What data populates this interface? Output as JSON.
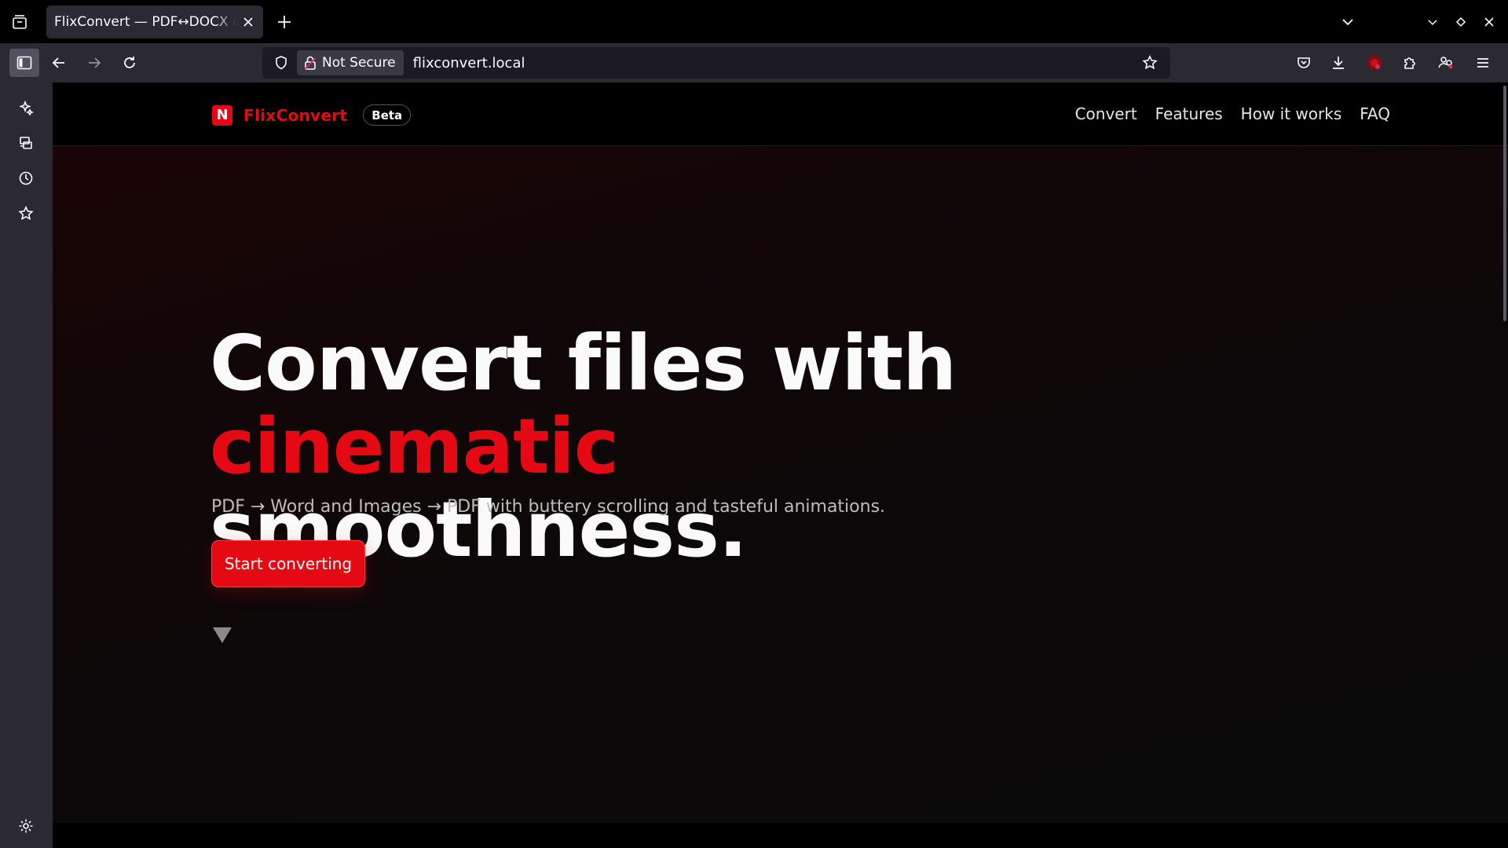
{
  "browser": {
    "tab_title": "FlixConvert — PDF↔DOCX & Images",
    "security_label": "Not Secure",
    "url": "flixconvert.local"
  },
  "site": {
    "brand_letter": "N",
    "brand_name": "FlixConvert",
    "badge": "Beta",
    "nav": [
      "Convert",
      "Features",
      "How it works",
      "FAQ"
    ]
  },
  "hero": {
    "title_part1": "Convert files with ",
    "title_accent": "cinematic",
    "title_part2": "smoothness.",
    "subtitle": "PDF → Word and Images → PDF with buttery scrolling and tasteful animations.",
    "cta_label": "Start converting"
  },
  "colors": {
    "accent": "#e50914",
    "chrome": "#2b2a33",
    "page_bg": "#000000"
  },
  "icons": {
    "sidebar": [
      "ai-chatbot-icon",
      "synced-tabs-icon",
      "history-icon",
      "bookmarks-icon",
      "settings-icon"
    ],
    "toolbar": [
      "pocket-icon",
      "downloads-icon",
      "extension-icon",
      "extensions-icon",
      "account-icon",
      "menu-icon"
    ]
  }
}
